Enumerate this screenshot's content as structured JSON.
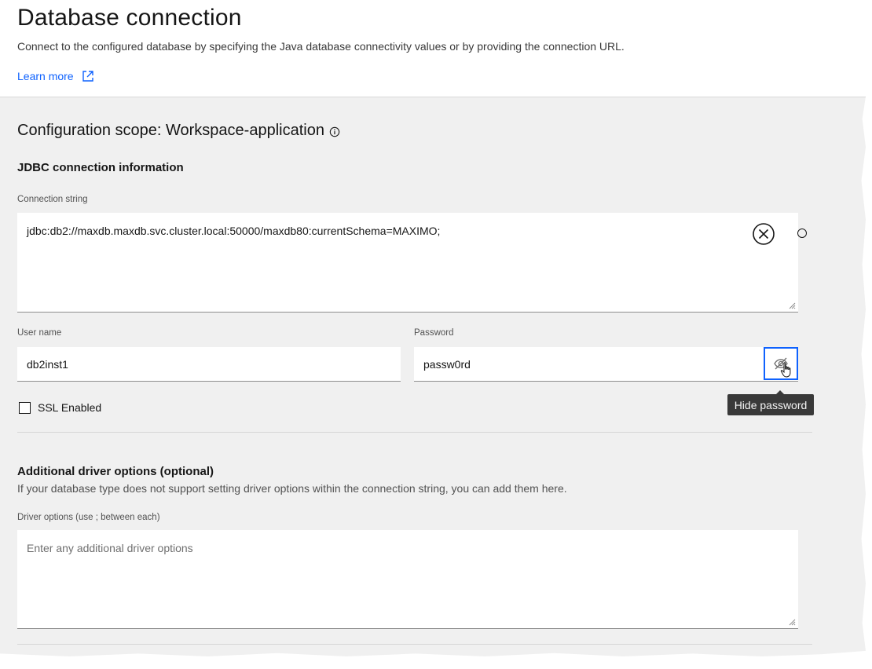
{
  "header": {
    "title": "Database connection",
    "description": "Connect to the configured database by specifying the Java database connectivity values or by providing the connection URL.",
    "learn_more": "Learn more"
  },
  "config": {
    "scope_label": "Configuration scope: Workspace-application",
    "jdbc_heading": "JDBC connection information",
    "connection_string_label": "Connection string",
    "connection_string_value": "jdbc:db2://maxdb.maxdb.svc.cluster.local:50000/maxdb80:currentSchema=MAXIMO;",
    "username_label": "User name",
    "username_value": "db2inst1",
    "password_label": "Password",
    "password_value": "passw0rd",
    "hide_password_tooltip": "Hide password",
    "ssl_label": "SSL Enabled",
    "ssl_checked": false
  },
  "driver": {
    "heading": "Additional driver options (optional)",
    "helper": "If your database type does not support setting driver options within the connection string, you can add them here.",
    "options_label": "Driver options (use ; between each)",
    "options_placeholder": "Enter any additional driver options"
  },
  "icons": {
    "external_link": "external-link-icon",
    "info": "info-icon",
    "clear": "close-circle-icon",
    "view_off": "view-off-icon",
    "cursor": "hand-cursor-icon"
  },
  "colors": {
    "link": "#0f62fe",
    "panel_bg": "#f0f0f0",
    "focus": "#0f62fe",
    "tooltip_bg": "#393939"
  }
}
